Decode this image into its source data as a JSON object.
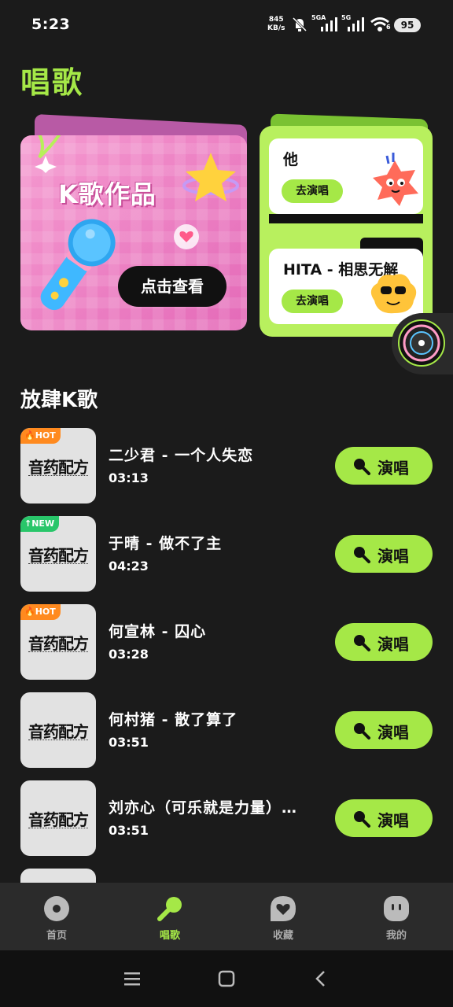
{
  "status_bar": {
    "time": "5:23",
    "net_rate_value": "845",
    "net_rate_unit": "KB/s",
    "signal1_label": "5GA",
    "signal2_label": "5G",
    "wifi_label": "6",
    "battery": "95"
  },
  "page": {
    "title": "唱歌"
  },
  "promo": {
    "title": "K歌作品",
    "button": "点击查看"
  },
  "recommend": {
    "items": [
      {
        "song": "他",
        "action": "去演唱"
      },
      {
        "song": "HITA - 相思无解",
        "action": "去演唱"
      }
    ]
  },
  "section": {
    "title": "放肆K歌"
  },
  "songs": [
    {
      "tag": "HOT",
      "cover": "音药配方",
      "title": "二少君 - 一个人失恋",
      "duration": "03:13",
      "action": "演唱"
    },
    {
      "tag": "NEW",
      "cover": "音药配方",
      "title": "于晴 - 做不了主",
      "duration": "04:23",
      "action": "演唱"
    },
    {
      "tag": "HOT",
      "cover": "音药配方",
      "title": "何宣林 - 囚心",
      "duration": "03:28",
      "action": "演唱"
    },
    {
      "tag": "",
      "cover": "音药配方",
      "title": "何村猪 - 散了算了",
      "duration": "03:51",
      "action": "演唱"
    },
    {
      "tag": "",
      "cover": "音药配方",
      "title": "刘亦心（可乐就是力量）…",
      "duration": "03:51",
      "action": "演唱"
    }
  ],
  "nav": {
    "items": [
      {
        "label": "首页",
        "icon": "disc-icon"
      },
      {
        "label": "唱歌",
        "icon": "microphone-icon"
      },
      {
        "label": "收藏",
        "icon": "heart-bubble-icon"
      },
      {
        "label": "我的",
        "icon": "face-icon"
      }
    ],
    "active": "唱歌"
  },
  "colors": {
    "accent": "#a5e847",
    "background": "#1b1b1b",
    "hot": "#ff8a1f",
    "new": "#29c66a"
  }
}
